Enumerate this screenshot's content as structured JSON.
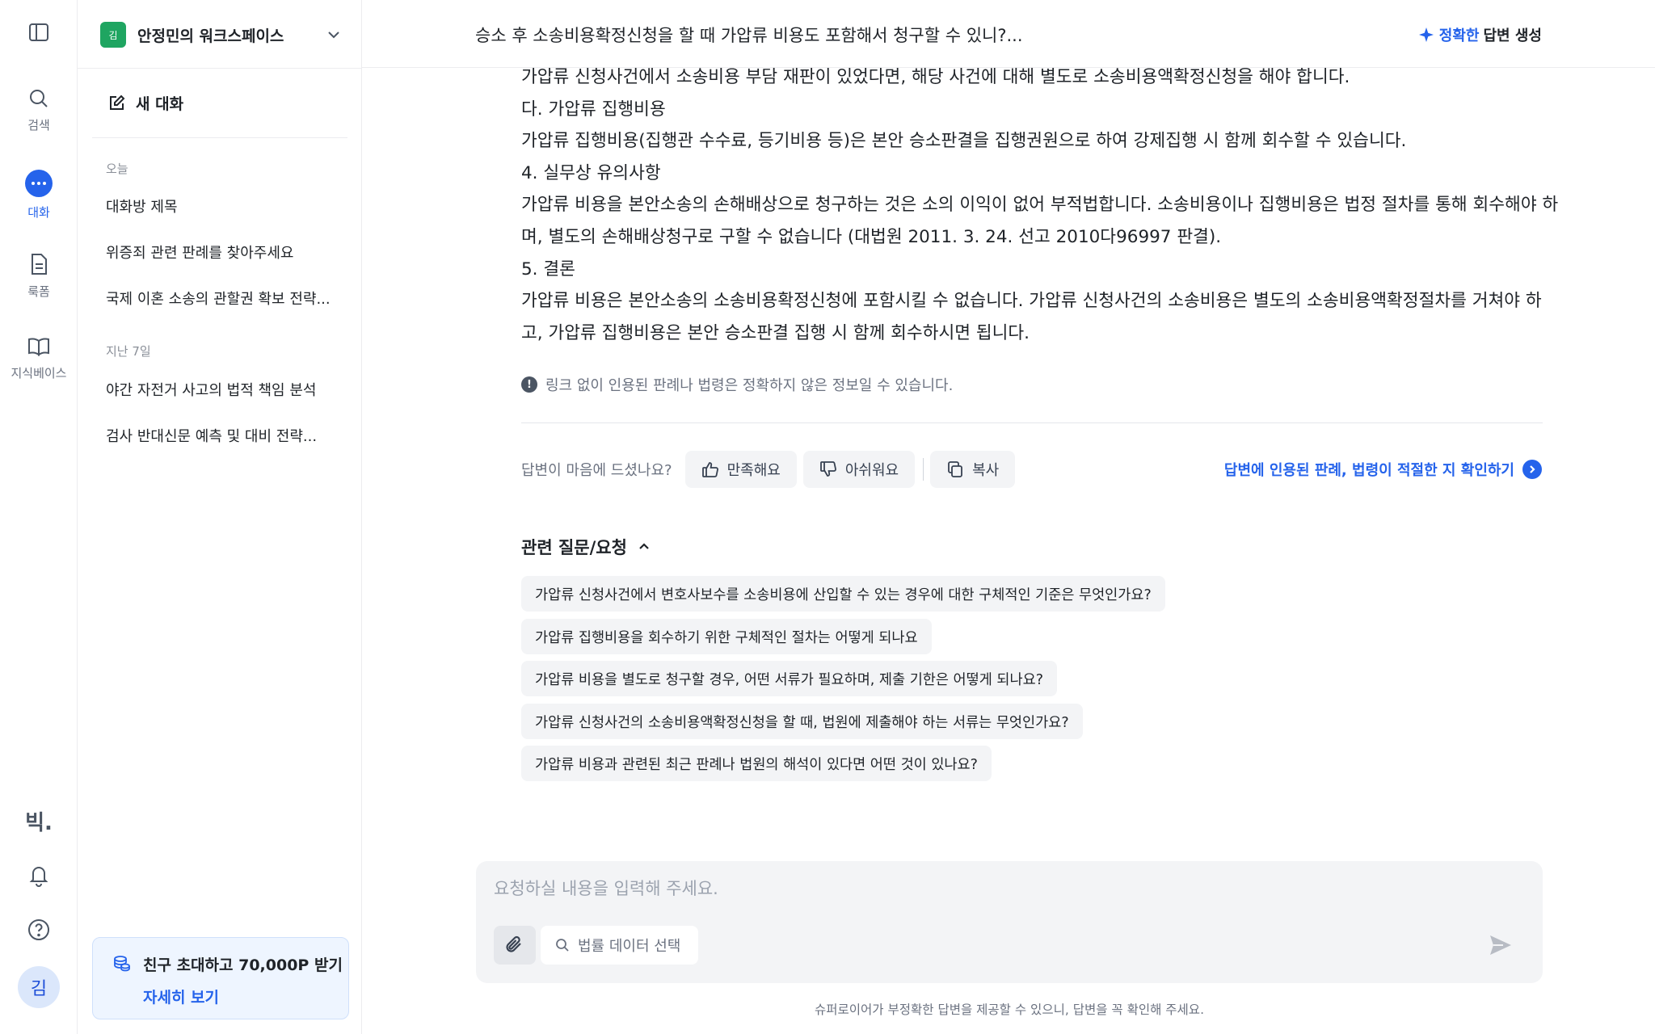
{
  "rail": {
    "search_label": "검색",
    "chat_label": "대화",
    "form_label": "룩폼",
    "kb_label": "지식베이스",
    "logo": "빅.",
    "avatar": "김",
    "accent_color": "#2563eb"
  },
  "sidebar": {
    "workspace_badge": "김",
    "workspace_name": "안정민의 워크스페이스",
    "new_chat": "새 대화",
    "groups": [
      {
        "label": "오늘",
        "items": [
          "대화방 제목",
          "위증죄 관련 판례를 찾아주세요",
          "국제 이혼 소송의 관할권 확보 전략..."
        ]
      },
      {
        "label": "지난 7일",
        "items": [
          "야간 자전거 사고의 법적 책임 분석",
          "검사 반대신문 예측 및 대비 전략..."
        ]
      }
    ],
    "promo": {
      "title": "친구 초대하고 70,000P 받기",
      "link": "자세히 보기"
    }
  },
  "header": {
    "title": "승소 후 소송비용확정신청을 할 때 가압류 비용도 포함해서 청구할 수 있니?...",
    "mode_accent": "정확한",
    "mode_rest": "답변 생성"
  },
  "answer": {
    "lines": [
      "가압류 신청사건에서 소송비용 부담 재판이 있었다면, 해당 사건에 대해 별도로 소송비용액확정신청을 해야 합니다.",
      "다. 가압류 집행비용",
      "가압류 집행비용(집행관 수수료, 등기비용 등)은 본안 승소판결을 집행권원으로 하여 강제집행 시 함께 회수할 수 있습니다.",
      "4. 실무상 유의사항",
      "가압류 비용을 본안소송의 손해배상으로 청구하는 것은 소의 이익이 없어 부적법합니다. 소송비용이나 집행비용은 법정 절차를 통해 회수해야 하",
      "며, 별도의 손해배상청구로 구할 수 없습니다 (대법원 2011. 3. 24. 선고 2010다96997 판결).",
      "5. 결론",
      "가압류 비용은 본안소송의 소송비용확정신청에 포함시킬 수 없습니다. 가압류 신청사건의 소송비용은 별도의 소송비용액확정절차를 거쳐야 하",
      "고, 가압류 집행비용은 본안 승소판결 집행 시 함께 회수하시면 됩니다."
    ],
    "disclaimer": "링크 없이 인용된 판례나 법령은 정확하지 않은 정보일 수 있습니다."
  },
  "feedback": {
    "question": "답변이 마음에 드셨나요?",
    "like": "만족해요",
    "dislike": "아쉬워요",
    "copy": "복사",
    "verify": "답변에 인용된 판례, 법령이 적절한 지 확인하기"
  },
  "related": {
    "title": "관련 질문/요청",
    "items": [
      "가압류 신청사건에서 변호사보수를 소송비용에 산입할 수 있는 경우에 대한 구체적인 기준은 무엇인가요?",
      "가압류 집행비용을 회수하기 위한 구체적인 절차는 어떻게 되나요",
      "가압류 비용을 별도로 청구할 경우, 어떤 서류가 필요하며, 제출 기한은 어떻게 되나요?",
      "가압류 신청사건의 소송비용액확정신청을 할 때, 법원에 제출해야 하는 서류는 무엇인가요?",
      "가압류 비용과 관련된 최근 판례나 법원의 해석이 있다면 어떤 것이 있나요?"
    ]
  },
  "composer": {
    "placeholder": "요청하실 내용을 입력해 주세요.",
    "data_select": "법률 데이터 선택",
    "footer": "슈퍼로이어가 부정확한 답변을 제공할 수 있으니, 답변을 꼭 확인해 주세요."
  }
}
